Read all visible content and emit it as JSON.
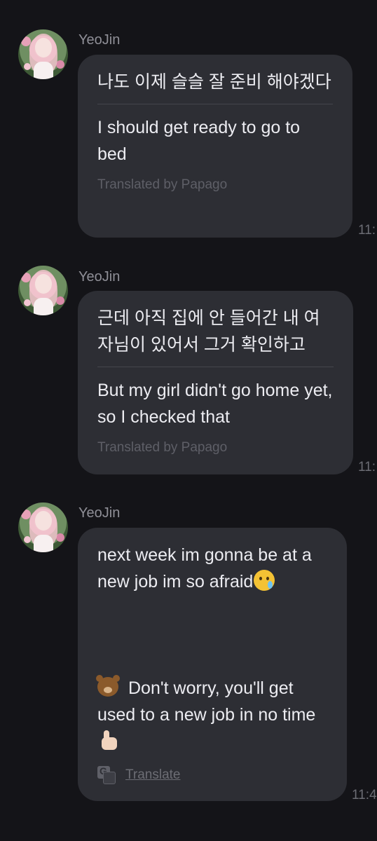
{
  "messages": [
    {
      "sender": "YeoJin",
      "original": "나도 이제 슬슬 잘 준비 해야겠다",
      "translated": "I should get ready to go to bed",
      "credit": "Translated by Papago",
      "time": "11:"
    },
    {
      "sender": "YeoJin",
      "original": "근데 아직 집에 안 들어간 내 여자님이 있어서 그거 확인하고",
      "translated": "But my girl didn't go home yet, so I checked that",
      "credit": "Translated by Papago",
      "time": "11:"
    },
    {
      "sender": "YeoJin",
      "text": "next week im gonna be at a new job im so afraid",
      "reply": "Don't worry, you'll get used to a new job in no time",
      "translate_label": "Translate",
      "time": "11:4"
    }
  ],
  "icons": {
    "cry": "crying-face-emoji",
    "bear": "bear-face-emoji",
    "thumbs": "thumbs-up-emoji",
    "translate": "translate-icon"
  }
}
